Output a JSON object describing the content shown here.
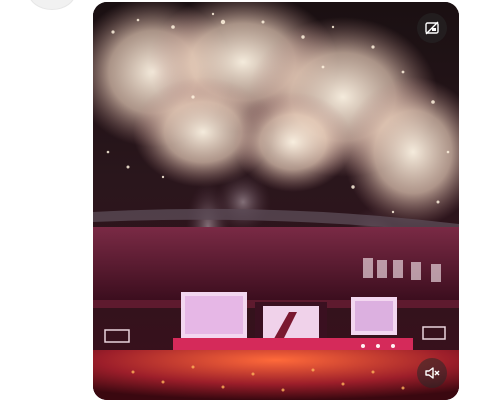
{
  "post": {
    "media": {
      "type": "video",
      "controls": {
        "top_right_icon": "picture-in-picture-off-icon",
        "bottom_right_icon": "volume-muted-icon"
      }
    }
  }
}
